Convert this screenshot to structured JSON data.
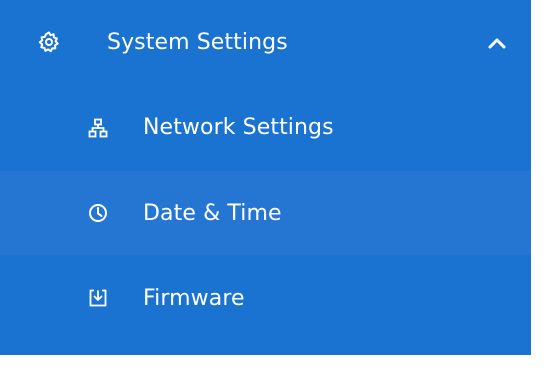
{
  "colors": {
    "menu_background": "#1a73d0",
    "active_row_background": "#2476d2",
    "text": "#ffffff"
  },
  "menu": {
    "header": {
      "label": "System Settings",
      "icon": "gear-icon",
      "expanded_indicator": "chevron-up-icon"
    },
    "items": [
      {
        "label": "Network Settings",
        "icon": "network-icon"
      },
      {
        "label": "Date & Time",
        "icon": "clock-icon",
        "active": true
      },
      {
        "label": "Firmware",
        "icon": "download-icon"
      }
    ]
  }
}
